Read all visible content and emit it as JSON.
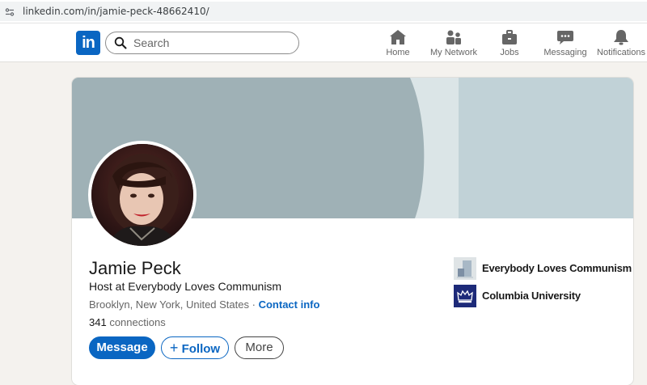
{
  "browser": {
    "url": "linkedin.com/in/jamie-peck-48662410/"
  },
  "nav": {
    "logo_text": "in",
    "search_placeholder": "Search",
    "items": [
      {
        "label": "Home",
        "icon": "home-icon"
      },
      {
        "label": "My Network",
        "icon": "network-icon"
      },
      {
        "label": "Jobs",
        "icon": "briefcase-icon"
      },
      {
        "label": "Messaging",
        "icon": "messaging-icon"
      },
      {
        "label": "Notifications",
        "icon": "bell-icon"
      }
    ]
  },
  "profile": {
    "name": "Jamie Peck",
    "headline": "Host at Everybody Loves Communism",
    "location": "Brooklyn, New York, United States",
    "separator": "·",
    "contact_label": "Contact info",
    "connections_count": "341",
    "connections_label": "connections"
  },
  "actions": {
    "message_label": "Message",
    "follow_label": "Follow",
    "follow_icon": "+",
    "more_label": "More"
  },
  "experience": [
    {
      "name": "Everybody Loves Communism",
      "logo": "org-logo-placeholder"
    },
    {
      "name": "Columbia University",
      "logo": "columbia-crown-logo"
    }
  ],
  "colors": {
    "linkedin_blue": "#0a66c2",
    "page_bg": "#f4f2ee",
    "banner_dark": "#9fb1b6",
    "banner_light": "#c1d2d7"
  }
}
